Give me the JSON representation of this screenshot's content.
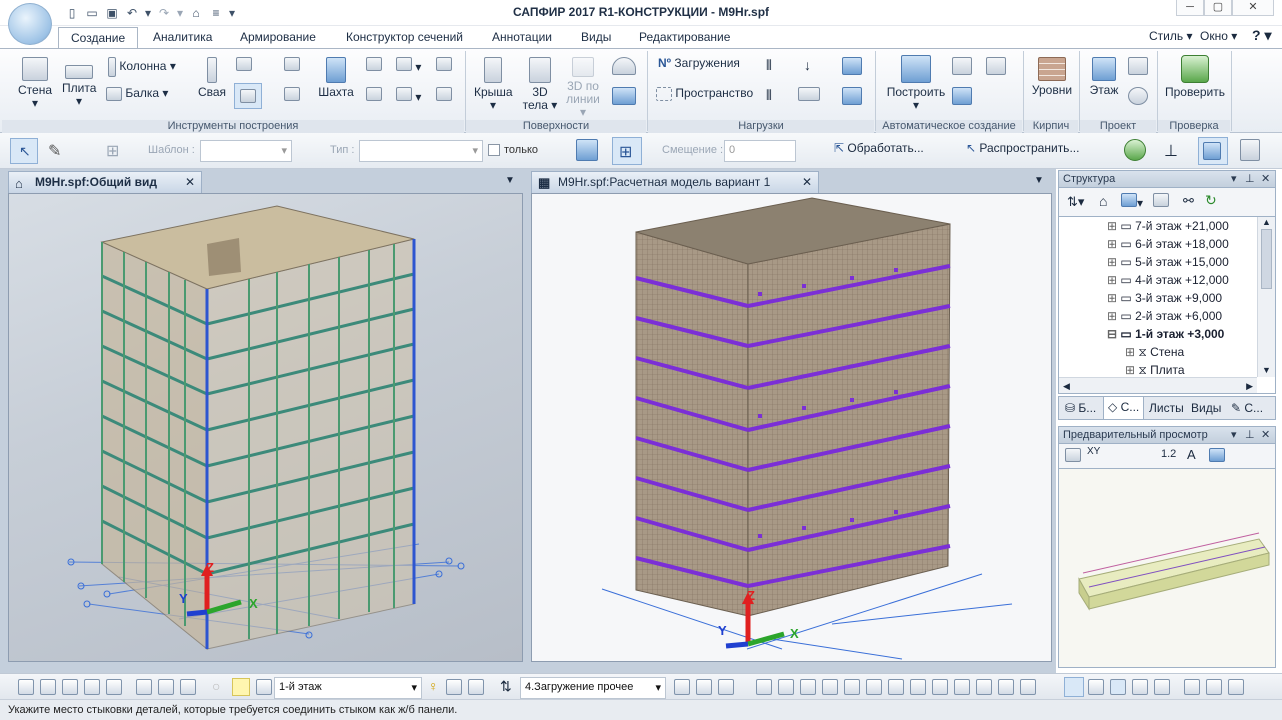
{
  "window": {
    "title": "САПФИР 2017 R1-КОНСТРУКЦИИ - М9Нr.spf"
  },
  "tabs": [
    "Создание",
    "Аналитика",
    "Армирование",
    "Конструктор сечений",
    "Аннотации",
    "Виды",
    "Редактирование"
  ],
  "tabs_right": {
    "style": "Стиль",
    "window": "Окно",
    "help": "?"
  },
  "ribbon": {
    "building_tools": {
      "wall": "Стена",
      "slab": "Плита",
      "column": "Колонна",
      "beam": "Балка",
      "pile": "Свая",
      "shaft": "Шахта",
      "label": "Инструменты построения"
    },
    "surfaces": {
      "roof": "Крыша",
      "bodies_3d_a": "3D",
      "bodies_3d_b": "тела",
      "line_3d_a": "3D по",
      "line_3d_b": "линии",
      "label": "Поверхности"
    },
    "loads": {
      "loadings": "Загружения",
      "space": "Пространство",
      "label": "Нагрузки"
    },
    "auto": {
      "build": "Построить",
      "label": "Автоматическое создание"
    },
    "brick": {
      "levels": "Уровни",
      "label": "Кирпич"
    },
    "project": {
      "floor": "Этаж",
      "label": "Проект"
    },
    "check": {
      "verify": "Проверить",
      "label": "Проверка"
    }
  },
  "toolbar2": {
    "template_label": "Шаблон :",
    "type_label": "Тип :",
    "only_label": "только",
    "offset_label": "Смещение :",
    "offset_value": "0",
    "process_label": "Обработать...",
    "spread_label": "Распространить..."
  },
  "views": {
    "left_tab": "М9Нr.spf:Общий вид",
    "right_tab": "М9Нr.spf:Расчетная модель вариант 1"
  },
  "axes": {
    "z": "Z",
    "y": "Y",
    "x": "X"
  },
  "structure": {
    "title": "Структура",
    "items": [
      {
        "label": "7-й этаж +21,000",
        "indent": 0,
        "bold": false
      },
      {
        "label": "6-й этаж +18,000",
        "indent": 0,
        "bold": false
      },
      {
        "label": "5-й этаж +15,000",
        "indent": 0,
        "bold": false
      },
      {
        "label": "4-й этаж +12,000",
        "indent": 0,
        "bold": false
      },
      {
        "label": "3-й этаж +9,000",
        "indent": 0,
        "bold": false
      },
      {
        "label": "2-й этаж +6,000",
        "indent": 0,
        "bold": false
      },
      {
        "label": "1-й этаж +3,000",
        "indent": 0,
        "bold": true
      },
      {
        "label": "Стена",
        "indent": 1,
        "bold": false
      },
      {
        "label": "Плита",
        "indent": 1,
        "bold": false
      }
    ],
    "tabs": [
      "Б...",
      "С...",
      "Листы",
      "Виды",
      "С..."
    ]
  },
  "preview": {
    "title": "Предварительный просмотр",
    "tools": [
      "XY",
      "1.2",
      "A"
    ]
  },
  "bottombar": {
    "floor_select": "1-й этаж",
    "load_select": "4.Загружение прочее"
  },
  "status": {
    "text": "Укажите место стыковки деталей, которые требуется соединить стыком как ж/б панели."
  },
  "colors": {
    "accent": "#2b5797",
    "mesh_purple": "#7b2fd6",
    "building_tan": "#a89986"
  }
}
